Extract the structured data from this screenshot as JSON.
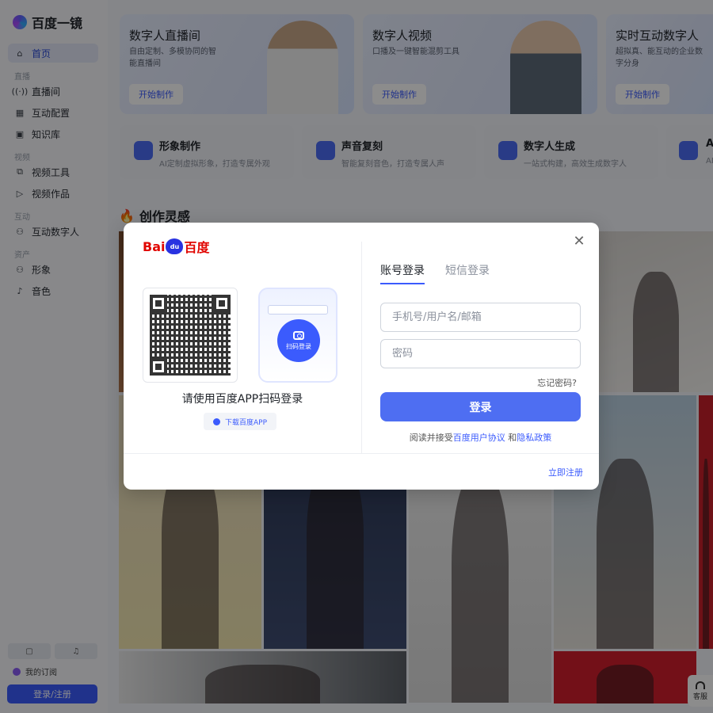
{
  "brand": {
    "name": "百度一镜"
  },
  "sidebar": {
    "home": "首页",
    "groups": {
      "live": "直播",
      "video": "视频",
      "interactive": "互动",
      "assets": "资产"
    },
    "items": {
      "live_room": "直播间",
      "interactive_config": "互动配置",
      "knowledge": "知识库",
      "video_tools": "视频工具",
      "video_works": "视频作品",
      "interactive_human": "互动数字人",
      "avatar": "形象",
      "voice": "音色"
    },
    "subscription": "我的订阅",
    "login_register": "登录/注册"
  },
  "cards": [
    {
      "title": "数字人直播间",
      "desc": "自由定制、多模协同的智能直播间",
      "button": "开始制作"
    },
    {
      "title": "数字人视频",
      "desc": "口播及一键智能混剪工具",
      "button": "开始制作"
    },
    {
      "title": "实时互动数字人",
      "desc": "超拟真、能互动的企业数字分身",
      "button": "开始制作"
    }
  ],
  "tools": [
    {
      "title": "形象制作",
      "desc": "AI定制虚拟形象，打造专属外观"
    },
    {
      "title": "声音复刻",
      "desc": "智能复刻音色，打造专属人声"
    },
    {
      "title": "数字人生成",
      "desc": "一站式构建，高效生成数字人"
    },
    {
      "title": "A",
      "desc": "AI"
    }
  ],
  "section": {
    "title": "创作灵感"
  },
  "modal": {
    "logo_text_left": "Bai",
    "logo_text_paw": "du",
    "logo_text_right": "百度",
    "scan_label": "扫码登录",
    "qr_hint": "请使用百度APP扫码登录",
    "download_app": "下载百度APP",
    "tabs": {
      "account": "账号登录",
      "sms": "短信登录"
    },
    "username_placeholder": "手机号/用户名/邮箱",
    "password_placeholder": "密码",
    "forgot": "忘记密码?",
    "login": "登录",
    "agree_prefix": "阅读并接受",
    "agreement": "百度用户协议",
    "and": "和",
    "privacy": "隐私政策",
    "register": "立即注册"
  },
  "service": {
    "label": "客服"
  },
  "colors": {
    "accent": "#3b5bfd",
    "login_button": "#4e6ef2",
    "baidu_red": "#e10601"
  }
}
